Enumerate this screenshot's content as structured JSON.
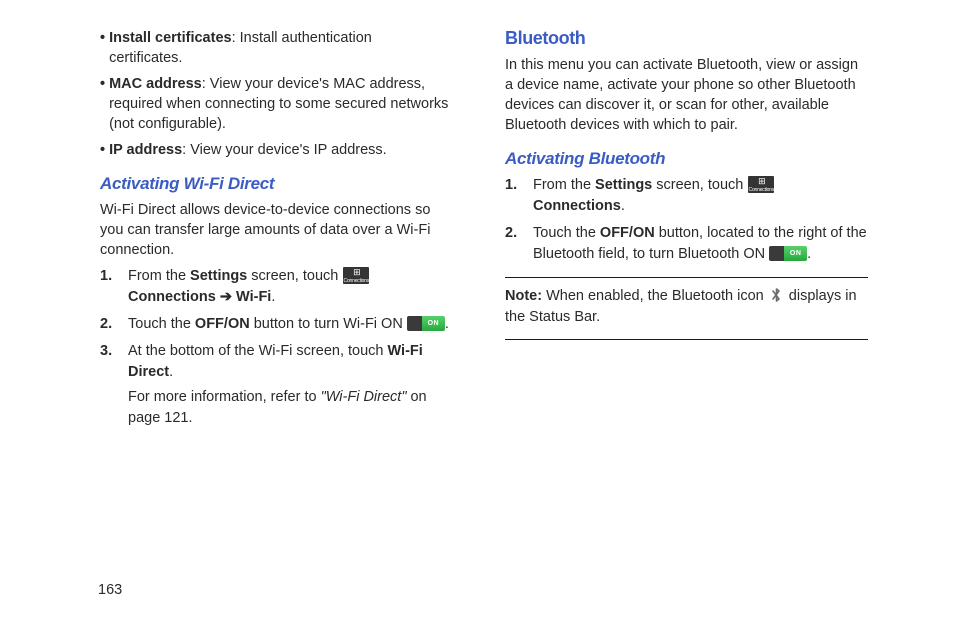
{
  "page_number": "163",
  "left": {
    "bullets": [
      {
        "label": "Install certificates",
        "text": ": Install authentication certificates."
      },
      {
        "label": "MAC address",
        "text": ": View your device's MAC address, required when connecting to some secured networks (not configurable)."
      },
      {
        "label": "IP address",
        "text": ": View your device's IP address."
      }
    ],
    "subheading": "Activating Wi-Fi Direct",
    "intro": "Wi-Fi Direct allows device-to-device connections so you can transfer large amounts of data over a Wi-Fi connection.",
    "steps": {
      "s1a": "From the ",
      "s1_settings": "Settings",
      "s1b": " screen, touch ",
      "conn_icon_label": "Connections",
      "s1_connections": "Connections",
      "arrow": "➔",
      "s1_wifi": "Wi-Fi",
      "s2a": "Touch the ",
      "s2_offon": "OFF/ON",
      "s2b": " button to turn Wi-Fi ON ",
      "toggle_on": "ON",
      "s3a": "At the bottom of the Wi-Fi screen, touch ",
      "s3_wfd": "Wi-Fi Direct",
      "s3_more": "For more information, refer to ",
      "s3_ref": "\"Wi-Fi Direct\"",
      "s3_page": " on page 121."
    }
  },
  "right": {
    "heading": "Bluetooth",
    "intro": "In this menu you can activate Bluetooth, view or assign a device name, activate your phone so other Bluetooth devices can discover it, or scan for other, available Bluetooth devices with which to pair.",
    "subheading": "Activating Bluetooth",
    "steps": {
      "s1a": "From the ",
      "s1_settings": "Settings",
      "s1b": " screen, touch ",
      "conn_icon_label": "Connections",
      "s1_connections": "Connections",
      "s2a": "Touch the ",
      "s2_offon": "OFF/ON",
      "s2b": " button, located to the right of the Bluetooth field, to turn Bluetooth ON ",
      "toggle_on": "ON"
    },
    "note_label": "Note:",
    "note_a": " When enabled, the Bluetooth icon ",
    "note_b": " displays in the Status Bar."
  }
}
